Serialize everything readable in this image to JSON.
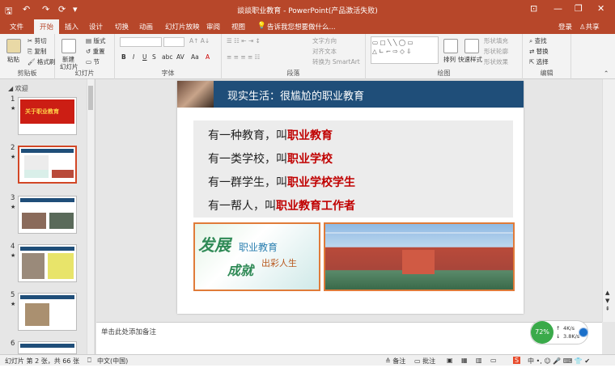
{
  "window": {
    "title": "談談职业教育 - PowerPoint(产品激活失败)",
    "qat": {
      "save_icon": "save-icon",
      "undo_icon": "undo-icon",
      "redo_icon": "redo-icon",
      "more_icon": "customize-icon"
    },
    "buttons": {
      "ribbon_display": "⊡",
      "minimize": "—",
      "restore": "❐",
      "close": "✕"
    }
  },
  "tabs": [
    "文件",
    "开始",
    "插入",
    "设计",
    "切换",
    "动画",
    "幻灯片放映",
    "审阅",
    "视图"
  ],
  "active_tab": "开始",
  "tell_me": "告诉我您想要做什么...",
  "account": {
    "login": "登录",
    "share": "共享"
  },
  "ribbon": {
    "clipboard": {
      "label": "剪贴板",
      "paste": "粘贴",
      "cut": "剪切",
      "copy": "复制",
      "format_painter": "格式刷"
    },
    "slides": {
      "label": "幻灯片",
      "new_slide": "新建",
      "new_slide2": "幻灯片",
      "layout": "版式",
      "reset": "重置",
      "section": "节"
    },
    "font": {
      "label": "字体",
      "bold": "B",
      "italic": "I",
      "underline": "U",
      "strike": "S",
      "shadow": "abc",
      "spacing": "AV",
      "case": "Aa",
      "color": "A"
    },
    "paragraph": {
      "label": "段落",
      "text_direction": "文字方向",
      "align_text": "对齐文本",
      "smartart": "转换为 SmartArt"
    },
    "drawing": {
      "label": "绘图",
      "arrange": "排列",
      "quick_styles": "快速样式",
      "shape_fill": "形状填充",
      "shape_outline": "形状轮廓",
      "shape_effects": "形状效果"
    },
    "editing": {
      "label": "编辑",
      "find": "查找",
      "replace": "替换",
      "select": "选择"
    }
  },
  "thumbnail_pane": {
    "section_name": "欢迎",
    "slides": [
      {
        "num": "1",
        "star": "★",
        "caption": "关于职业教育"
      },
      {
        "num": "2",
        "star": "★"
      },
      {
        "num": "3",
        "star": "★"
      },
      {
        "num": "4",
        "star": "★"
      },
      {
        "num": "5",
        "star": "★"
      },
      {
        "num": "6",
        "star": "★"
      }
    ]
  },
  "slide": {
    "title": "现实生活：很尴尬的职业教育",
    "lines": [
      {
        "prefix": "有一种教育，叫",
        "emphasis": "职业教育"
      },
      {
        "prefix": "有一类学校，叫",
        "emphasis": "职业学校"
      },
      {
        "prefix": "有一群学生，叫",
        "emphasis": "职业学校学生"
      },
      {
        "prefix": "有一帮人，叫",
        "emphasis": "职业教育工作者"
      }
    ],
    "image1_text": {
      "big1": "发展",
      "small1": "职业教育",
      "big2": "成就",
      "small2": "出彩人生"
    }
  },
  "notes_placeholder": "单击此处添加备注",
  "status": {
    "slide_info": "幻灯片 第 2 张，共 66 张",
    "language": "中文(中国)",
    "notes": "备注",
    "comments": "批注"
  },
  "net_widget": {
    "percent": "72%",
    "up": "4K/s",
    "down": "3.8K/s"
  },
  "colors": {
    "accent": "#b7472a",
    "slide_header": "#1f4e79",
    "emphasis": "#c00000",
    "frame": "#e07b39"
  }
}
